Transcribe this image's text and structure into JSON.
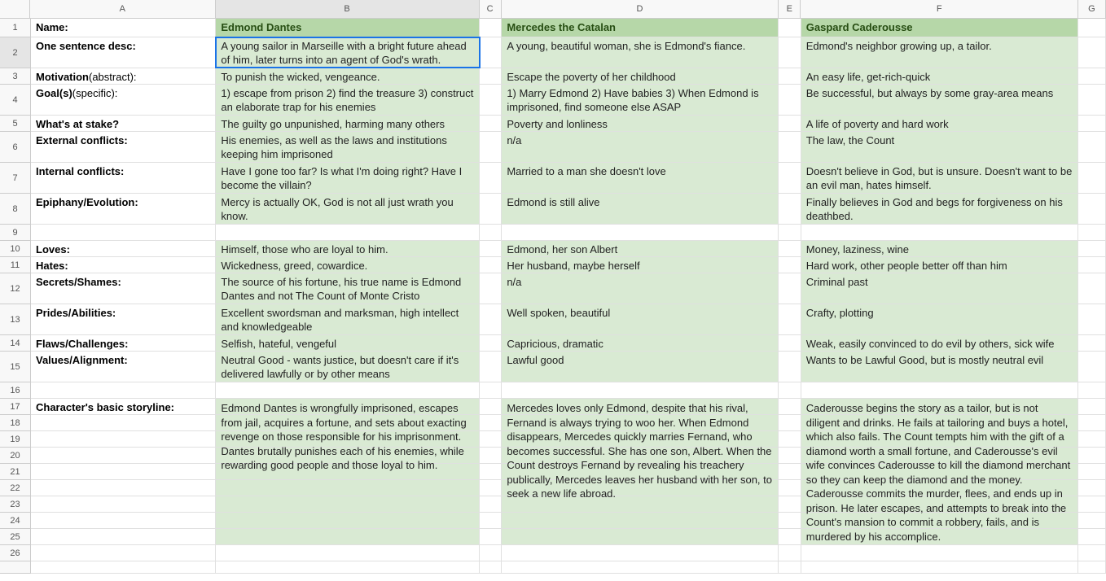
{
  "columns": [
    "A",
    "B",
    "C",
    "D",
    "E",
    "F",
    "G"
  ],
  "rowLabels": {
    "1": "Name:",
    "2": "One sentence desc:",
    "3_prefix": "Motivation",
    "3_suffix": " (abstract):",
    "4_prefix": "Goal(s)",
    "4_suffix": " (specific):",
    "5": "What's at stake?",
    "6": "External conflicts:",
    "7": "Internal conflicts:",
    "8": "Epiphany/Evolution:",
    "10": "Loves:",
    "11": "Hates:",
    "12": "Secrets/Shames:",
    "13": "Prides/Abilities:",
    "14": "Flaws/Challenges:",
    "15": "Values/Alignment:",
    "17": "Character's basic storyline:"
  },
  "characters": {
    "B": {
      "name": "Edmond Dantes",
      "desc": "A young sailor in Marseille with a bright future ahead of him, later turns into an agent of God's wrath.",
      "motivation": "To punish the wicked, vengeance.",
      "goals": "1) escape from prison  2) find the treasure  3) construct an elaborate trap for his enemies",
      "stake": "The guilty go unpunished, harming many others",
      "external": "His enemies, as well as the laws and institutions keeping him imprisoned",
      "internal": "Have I gone too far?  Is what I'm doing right?  Have I become the villain?",
      "epiphany": "Mercy is actually OK, God is not all just wrath you know.",
      "loves": "Himself, those who are loyal to him.",
      "hates": "Wickedness, greed, cowardice.",
      "secrets": "The source of his fortune, his true name is Edmond Dantes and not The Count of Monte Cristo",
      "prides": "Excellent swordsman and marksman, high intellect and knowledgeable",
      "flaws": "Selfish, hateful, vengeful",
      "values": "Neutral Good - wants justice, but doesn't care if it's delivered lawfully or by other means",
      "storyline": "Edmond Dantes is wrongfully imprisoned, escapes from jail, acquires a fortune, and sets about exacting revenge on those responsible for his imprisonment. Dantes brutally punishes each of his enemies, while rewarding good people and those loyal to him."
    },
    "D": {
      "name": "Mercedes the Catalan",
      "desc": "A young, beautiful woman, she is Edmond's fiance.",
      "motivation": "Escape the poverty of her childhood",
      "goals": "1) Marry Edmond  2) Have babies  3) When Edmond is imprisoned, find someone else ASAP",
      "stake": "Poverty and lonliness",
      "external": "n/a",
      "internal": "Married to a man she doesn't love",
      "epiphany": "Edmond is still alive",
      "loves": "Edmond, her son Albert",
      "hates": "Her husband, maybe herself",
      "secrets": "n/a",
      "prides": "Well spoken, beautiful",
      "flaws": "Capricious, dramatic",
      "values": "Lawful good",
      "storyline": "Mercedes loves only Edmond, despite that his rival, Fernand is always trying to woo her.  When Edmond disappears, Mercedes quickly marries Fernand, who becomes successful.  She has one son, Albert.  When the Count destroys Fernand by revealing his treachery publically, Mercedes leaves her husband with her son, to seek a new life abroad."
    },
    "F": {
      "name": "Gaspard Caderousse",
      "desc": "Edmond's neighbor growing up, a tailor.",
      "motivation": "An easy life, get-rich-quick",
      "goals": "Be successful, but always by some gray-area means",
      "stake": "A life of poverty and hard work",
      "external": "The law, the Count",
      "internal": "Doesn't believe in God, but is unsure.  Doesn't want to be an evil man, hates himself.",
      "epiphany": "Finally believes in God and begs for forgiveness on his deathbed.",
      "loves": "Money, laziness, wine",
      "hates": "Hard work, other people better off than him",
      "secrets": "Criminal past",
      "prides": "Crafty, plotting",
      "flaws": "Weak, easily convinced to do evil by others, sick wife",
      "values": "Wants to be Lawful Good, but is mostly neutral evil",
      "storyline": "Caderousse begins the story as a tailor, but is not diligent and drinks.  He fails at tailoring and buys a hotel, which also fails.  The Count tempts him with the gift of a diamond worth a small fortune, and Caderousse's evil wife convinces Caderousse to kill the diamond merchant so they can keep the diamond and the money.  Caderousse commits the murder, flees, and ends up in prison.  He later escapes, and attempts to break into the Count's mansion to commit a robbery, fails, and is murdered by his accomplice."
    }
  },
  "rowHeights": {
    "1": 23,
    "2": 38,
    "3": 20,
    "4": 38,
    "5": 20,
    "6": 38,
    "7": 38,
    "8": 38,
    "9": 20,
    "10": 20,
    "11": 20,
    "12": 38,
    "13": 38,
    "14": 20,
    "15": 38,
    "16": 20,
    "17": 20,
    "18": 20,
    "19": 20,
    "20": 20,
    "21": 20,
    "22": 20,
    "23": 20,
    "24": 20,
    "25": 20,
    "26": 20,
    "27": 15
  },
  "selectedCell": "B2"
}
